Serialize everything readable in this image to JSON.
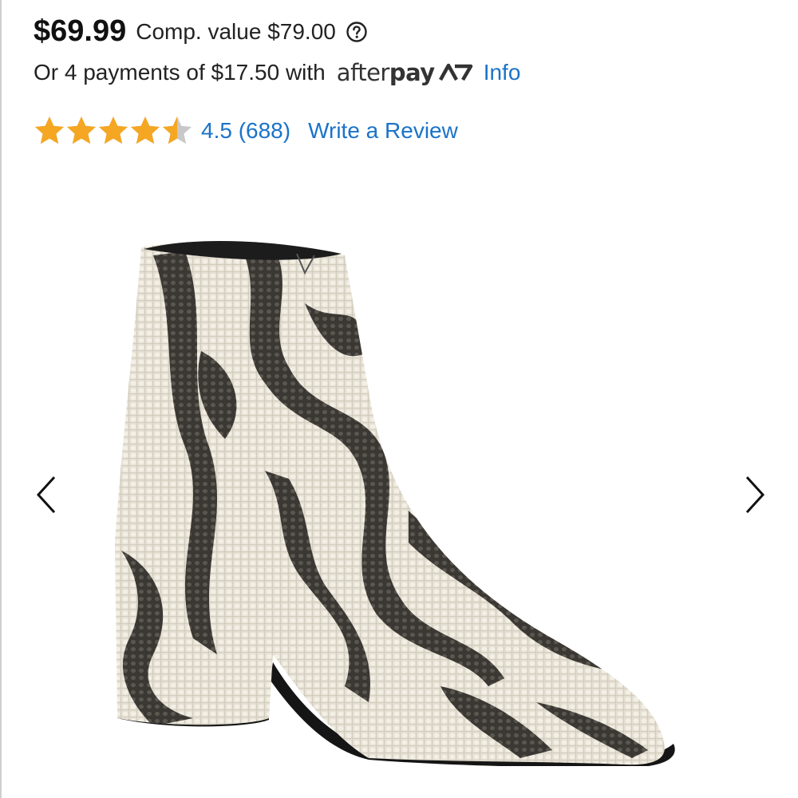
{
  "pricing": {
    "price": "$69.99",
    "comp_value": "Comp. value $79.00",
    "help_icon": "question-circle-icon"
  },
  "payments": {
    "text": "Or 4 payments of $17.50 with",
    "provider_light": "after",
    "provider_bold": "pay",
    "provider_icon": "afterpay-logo-icon",
    "info_label": "Info"
  },
  "rating": {
    "value": 4.5,
    "max": 5,
    "summary": "4.5 (688)",
    "write_review_label": "Write a Review",
    "star_color": "#f5a623",
    "empty_star_color": "#c8c8c8"
  },
  "gallery": {
    "prev_icon": "chevron-left-icon",
    "next_icon": "chevron-right-icon",
    "image": "snakeskin-ankle-boot-photo"
  },
  "colors": {
    "link": "#1a73c9",
    "text": "#222222"
  }
}
